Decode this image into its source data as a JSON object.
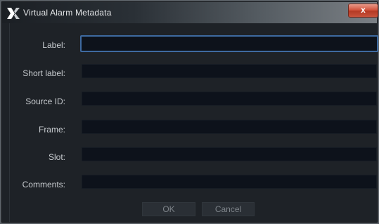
{
  "window": {
    "title": "Virtual Alarm Metadata",
    "close_label": "x"
  },
  "fields": [
    {
      "label": "Label:",
      "value": "",
      "focused": true
    },
    {
      "label": "Short label:",
      "value": ""
    },
    {
      "label": "Source ID:",
      "value": ""
    },
    {
      "label": "Frame:",
      "value": ""
    },
    {
      "label": "Slot:",
      "value": ""
    },
    {
      "label": "Comments:",
      "value": ""
    }
  ],
  "buttons": {
    "ok_label": "OK",
    "cancel_label": "Cancel"
  },
  "icons": {
    "app": "x-logo-icon",
    "close": "close-icon"
  },
  "colors": {
    "window_bg": "#1e2227",
    "field_bg": "#0d121b",
    "focus_border": "#3e6aa0",
    "close_button": "#c7533c"
  }
}
